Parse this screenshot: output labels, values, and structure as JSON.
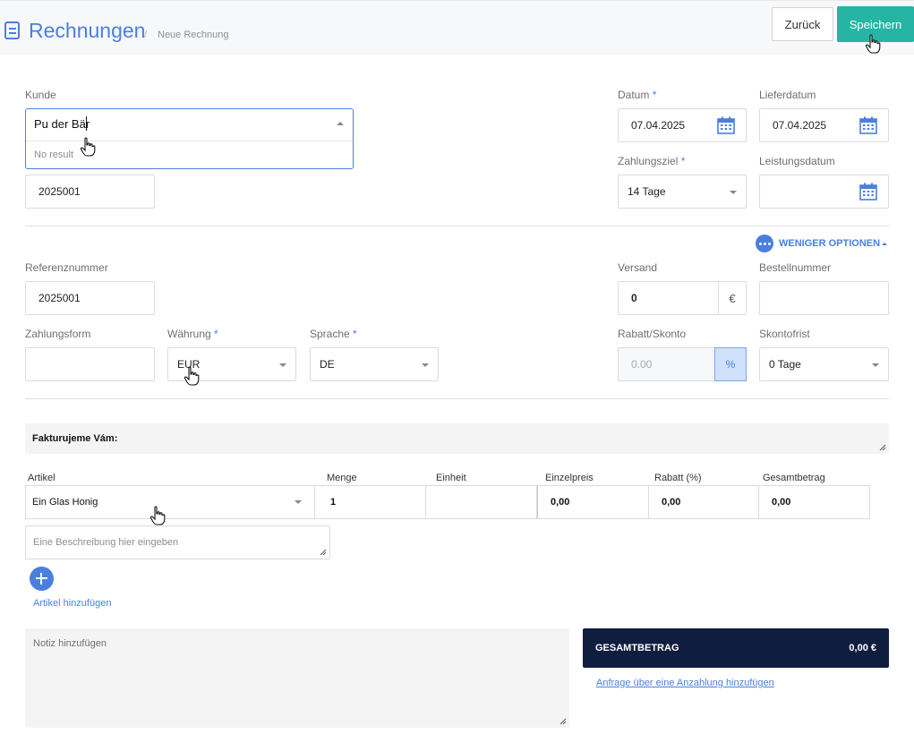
{
  "header": {
    "title": "Rechnungen",
    "breadcrumb_sep": "/",
    "breadcrumb": "Neue Rechnung",
    "back_label": "Zurück",
    "save_label": "Speichern",
    "accent_color": "#4a7fe0",
    "save_color": "#26b5a5"
  },
  "customer": {
    "label": "Kunde",
    "value": "Pu der Bär",
    "dropdown_empty": "No result",
    "number_value": "2025001"
  },
  "dates": {
    "datum_label": "Datum",
    "datum_value": "07.04.2025",
    "lieferdatum_label": "Lieferdatum",
    "lieferdatum_value": "07.04.2025",
    "zahlungsziel_label": "Zahlungsziel",
    "zahlungsziel_value": "14 Tage",
    "leistungsdatum_label": "Leistungsdatum",
    "leistungsdatum_value": ""
  },
  "options": {
    "toggle_label": "WENIGER OPTIONEN",
    "referenz_label": "Referenznummer",
    "referenz_value": "2025001",
    "versand_label": "Versand",
    "versand_value": "0",
    "versand_currency": "€",
    "bestellnummer_label": "Bestellnummer",
    "bestellnummer_value": "",
    "zahlungsform_label": "Zahlungsform",
    "zahlungsform_value": "",
    "waehrung_label": "Währung",
    "waehrung_value": "EUR",
    "sprache_label": "Sprache",
    "sprache_value": "DE",
    "rabatt_label": "Rabatt/Skonto",
    "rabatt_placeholder": "0.00",
    "rabatt_unit": "%",
    "skontofrist_label": "Skontofrist",
    "skontofrist_value": "0 Tage"
  },
  "intro_text": "Fakturujeme Vám:",
  "items": {
    "headers": [
      "Artikel",
      "Menge",
      "Einheit",
      "Einzelpreis",
      "Rabatt (%)",
      "Gesamtbetrag"
    ],
    "row": {
      "artikel": "Ein Glas Honig",
      "menge": "1",
      "einheit": "",
      "einzelpreis": "0,00",
      "rabatt": "0,00",
      "gesamt": "0,00"
    },
    "description_placeholder": "Eine Beschreibung hier eingeben",
    "add_label": "Artikel hinzufügen"
  },
  "notes": {
    "placeholder": "Notiz hinzufügen"
  },
  "totals": {
    "label": "GESAMTBETRAG",
    "value": "0,00 €",
    "link": "Anfrage über eine Anzahlung hinzufügen",
    "bg_color": "#0f1d3f"
  }
}
